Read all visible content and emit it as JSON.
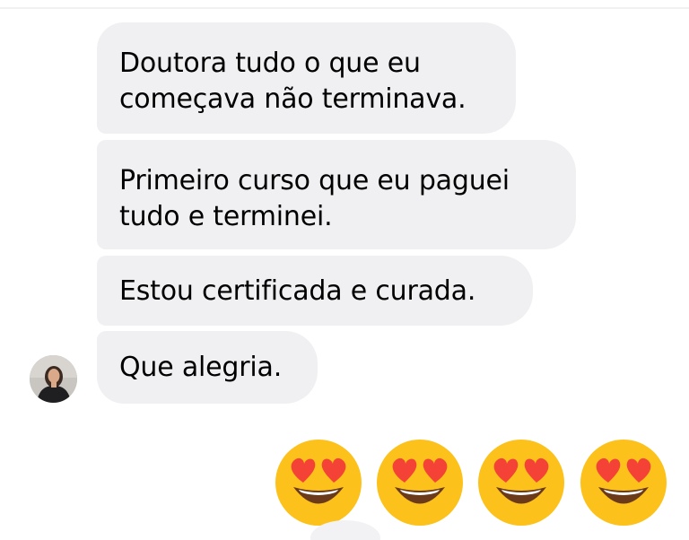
{
  "messages": [
    {
      "lines": [
        "Doutora tudo o que eu",
        "começava não terminava."
      ]
    },
    {
      "lines": [
        "Primeiro curso que eu paguei",
        "tudo e terminei."
      ]
    },
    {
      "lines": [
        "Estou certificada e curada."
      ]
    },
    {
      "lines": [
        "Que alegria."
      ]
    }
  ],
  "reaction": {
    "icon": "heart-eyes-emoji",
    "count_shown": 4
  },
  "colors": {
    "bubble_bg": "#f0f0f2",
    "text": "#000000",
    "emoji_face": "#fcc21b",
    "emoji_heart": "#f44336"
  }
}
